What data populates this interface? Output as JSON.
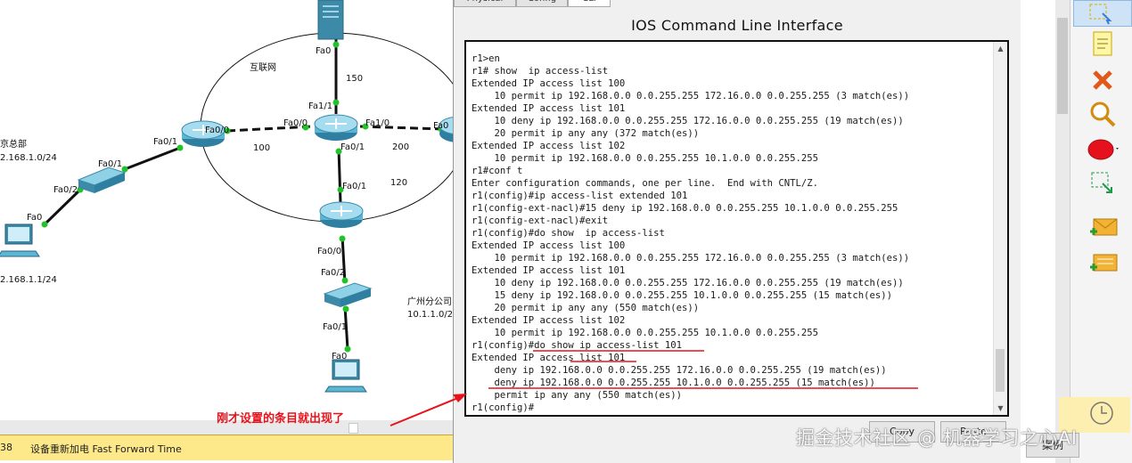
{
  "topology": {
    "internet_label": "互联网",
    "bj_label": "京总部",
    "bj_net": "2.168.1.0/24",
    "bj_pc_ip": "2.168.1.1/24",
    "gz_label": "广州分公司",
    "gz_net": "10.1.1.0/2",
    "ports": {
      "server_fa0": "Fa0",
      "isp_fa1_1": "Fa1/1",
      "isp_fa0_0": "Fa0/0",
      "isp_fa1_0": "Fa1/0",
      "isp_fa0_1": "Fa0/1",
      "right_fa0": "Fa0",
      "r1_fa0_0": "Fa0/0",
      "r1_fa0_1": "Fa0/1",
      "sw1_fa0_1": "Fa0/1",
      "sw1_fa0_2": "Fa0/2",
      "pc1_fa0": "Fa0",
      "r3_fa0_1": "Fa0/1",
      "r3_fa0_0": "Fa0/0",
      "sw2_fa0_2": "Fa0/2",
      "sw2_fa0_1": "Fa0/1",
      "pc2_fa0": "Fa0"
    },
    "links": {
      "l150": "150",
      "l100": "100",
      "l200": "200",
      "l120": "120"
    }
  },
  "annotation": {
    "note": "刚才设置的条目就出现了"
  },
  "status_bar": {
    "count": "38",
    "text": "设备重新加电  Fast Forward Time"
  },
  "dialog": {
    "tabs": [
      "Physical",
      "Config",
      "CLI"
    ],
    "title": "IOS Command Line Interface",
    "copy_label": "Copy",
    "paste_label": "Paste",
    "lines": [
      "r1>en",
      "r1# show  ip access-list",
      "Extended IP access list 100",
      "    10 permit ip 192.168.0.0 0.0.255.255 172.16.0.0 0.0.255.255 (3 match(es))",
      "Extended IP access list 101",
      "    10 deny ip 192.168.0.0 0.0.255.255 172.16.0.0 0.0.255.255 (19 match(es))",
      "    20 permit ip any any (372 match(es))",
      "Extended IP access list 102",
      "    10 permit ip 192.168.0.0 0.0.255.255 10.1.0.0 0.0.255.255",
      "r1#conf t",
      "Enter configuration commands, one per line.  End with CNTL/Z.",
      "r1(config)#ip access-list extended 101",
      "r1(config-ext-nacl)#15 deny ip 192.168.0.0 0.0.255.255 10.1.0.0 0.0.255.255",
      "r1(config-ext-nacl)#exit",
      "r1(config)#do show  ip access-list",
      "Extended IP access list 100",
      "    10 permit ip 192.168.0.0 0.0.255.255 172.16.0.0 0.0.255.255 (3 match(es))",
      "Extended IP access list 101",
      "    10 deny ip 192.168.0.0 0.0.255.255 172.16.0.0 0.0.255.255 (19 match(es))",
      "    15 deny ip 192.168.0.0 0.0.255.255 10.1.0.0 0.0.255.255 (15 match(es))",
      "    20 permit ip any any (550 match(es))",
      "Extended IP access list 102",
      "    10 permit ip 192.168.0.0 0.0.255.255 10.1.0.0 0.0.255.255",
      "r1(config)#do show ip access-list 101",
      "Extended IP access list 101",
      "    deny ip 192.168.0.0 0.0.255.255 172.16.0.0 0.0.255.255 (19 match(es))",
      "    deny ip 192.168.0.0 0.0.255.255 10.1.0.0 0.0.255.255 (15 match(es))",
      "    permit ip any any (550 match(es))",
      "r1(config)#"
    ]
  },
  "right_panel": {
    "button_label": "案例"
  },
  "watermark": "掘金技术社区 @ 机器学习之心AI",
  "colors": {
    "annotation": "#e8121b",
    "link": "#111111",
    "port_dot": "#22c32a",
    "status_bar": "#fde98a"
  }
}
